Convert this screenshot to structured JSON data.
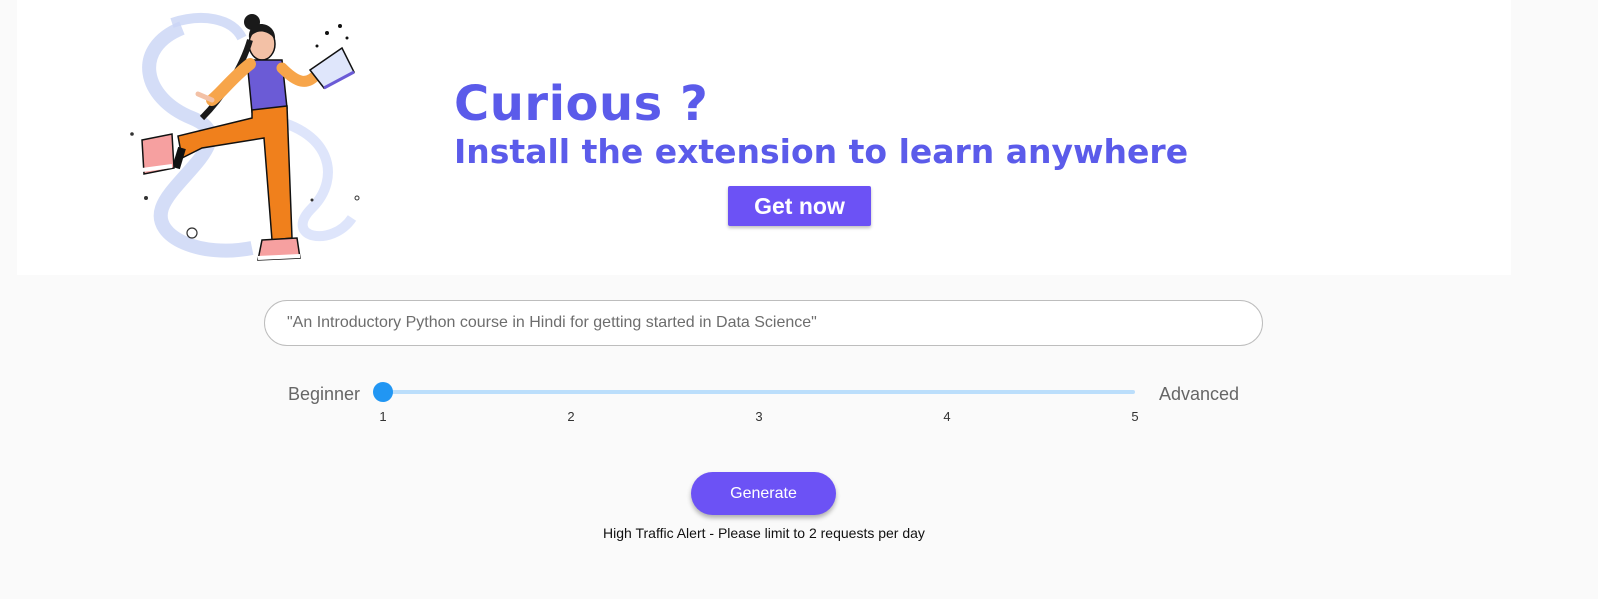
{
  "banner": {
    "headline": "Curious ?",
    "subheadline": "Install the extension to learn anywhere",
    "cta_label": "Get now"
  },
  "search": {
    "placeholder": "\"An Introductory Python course in Hindi for getting started in Data Science\"",
    "value": ""
  },
  "level_slider": {
    "min_label": "Beginner",
    "max_label": "Advanced",
    "ticks": [
      "1",
      "2",
      "3",
      "4",
      "5"
    ],
    "value": 1,
    "min": 1,
    "max": 5
  },
  "actions": {
    "generate_label": "Generate"
  },
  "notice": {
    "text": "High Traffic Alert - Please limit to 2 requests per day"
  },
  "colors": {
    "accent": "#6c52f5",
    "headline": "#5b5bea",
    "slider": "#2196f3"
  }
}
